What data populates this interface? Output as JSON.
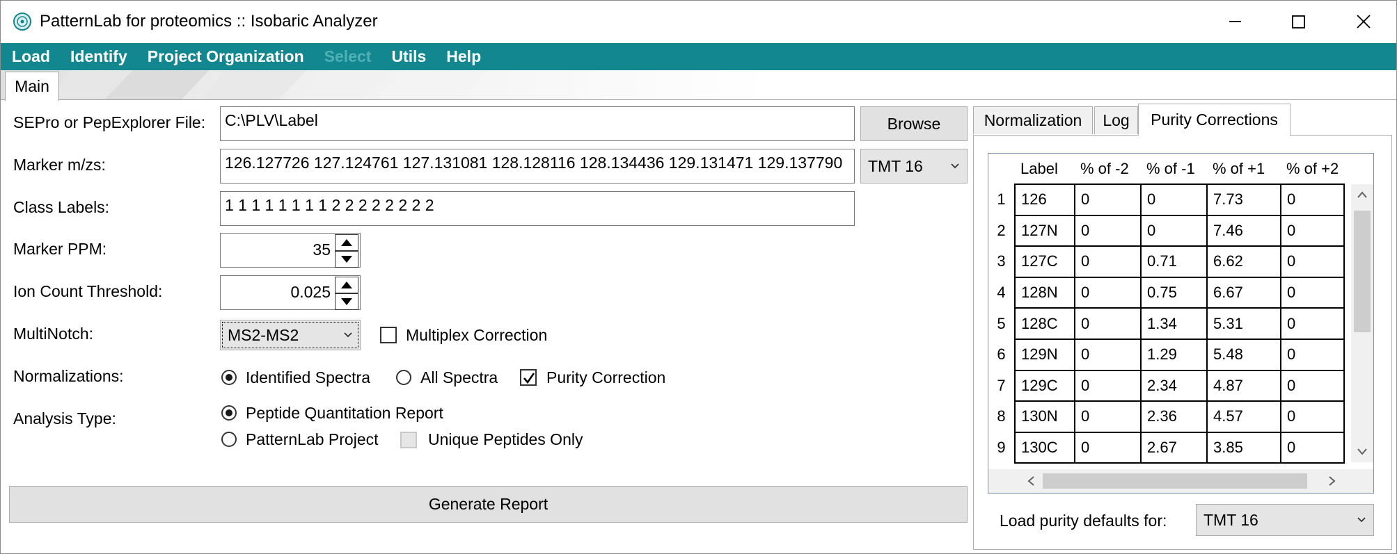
{
  "window": {
    "title": "PatternLab for proteomics :: Isobaric Analyzer",
    "minimize": "—",
    "maximize": "☐",
    "close": "✕"
  },
  "menu": [
    "Load",
    "Identify",
    "Project Organization",
    "Select",
    "Utils",
    "Help"
  ],
  "menu_disabled": [
    "Select"
  ],
  "main_tab": "Main",
  "form": {
    "sepro_label": "SEPro or PepExplorer File:",
    "sepro_value": "C:\\PLV\\Label",
    "browse": "Browse",
    "marker_label": "Marker m/zs:",
    "marker_value": "126.127726 127.124761 127.131081 128.128116 128.134436 129.131471 129.137790",
    "marker_preset": "TMT 16",
    "class_label": "Class Labels:",
    "class_value": "1 1 1 1 1 1 1 1 2 2 2 2 2 2 2 2",
    "ppm_label": "Marker PPM:",
    "ppm_value": "35",
    "ion_label": "Ion Count Threshold:",
    "ion_value": "0.025",
    "multinotch_label": "MultiNotch:",
    "multinotch_value": "MS2-MS2",
    "multiplex_label": "Multiplex Correction",
    "multiplex_checked": false,
    "norm_label": "Normalizations:",
    "norm_identified": "Identified Spectra",
    "norm_all": "All Spectra",
    "norm_selected": "Identified Spectra",
    "purity_label": "Purity Correction",
    "purity_checked": true,
    "analysis_label": "Analysis Type:",
    "analysis_peptide": "Peptide Quantitation Report",
    "analysis_project": "PatternLab Project",
    "analysis_selected": "Peptide Quantitation Report",
    "unique_label": "Unique Peptides Only",
    "unique_enabled": false,
    "generate": "Generate Report"
  },
  "right_tabs": [
    "Normalization",
    "Log",
    "Purity Corrections"
  ],
  "right_active": "Purity Corrections",
  "purity_table": {
    "headers": [
      "Label",
      "% of -2",
      "% of -1",
      "% of +1",
      "% of +2"
    ],
    "rows": [
      {
        "n": "1",
        "cells": [
          "126",
          "0",
          "0",
          "7.73",
          "0"
        ]
      },
      {
        "n": "2",
        "cells": [
          "127N",
          "0",
          "0",
          "7.46",
          "0"
        ]
      },
      {
        "n": "3",
        "cells": [
          "127C",
          "0",
          "0.71",
          "6.62",
          "0"
        ]
      },
      {
        "n": "4",
        "cells": [
          "128N",
          "0",
          "0.75",
          "6.67",
          "0"
        ]
      },
      {
        "n": "5",
        "cells": [
          "128C",
          "0",
          "1.34",
          "5.31",
          "0"
        ]
      },
      {
        "n": "6",
        "cells": [
          "129N",
          "0",
          "1.29",
          "5.48",
          "0"
        ]
      },
      {
        "n": "7",
        "cells": [
          "129C",
          "0",
          "2.34",
          "4.87",
          "0"
        ]
      },
      {
        "n": "8",
        "cells": [
          "130N",
          "0",
          "2.36",
          "4.57",
          "0"
        ]
      },
      {
        "n": "9",
        "cells": [
          "130C",
          "0",
          "2.67",
          "3.85",
          "0"
        ]
      }
    ]
  },
  "purity_defaults_label": "Load purity defaults for:",
  "purity_defaults_value": "TMT 16",
  "colors": {
    "menubar": "#13878f",
    "menu_text": "#ffffff",
    "menu_disabled": "#4fb0b6"
  }
}
